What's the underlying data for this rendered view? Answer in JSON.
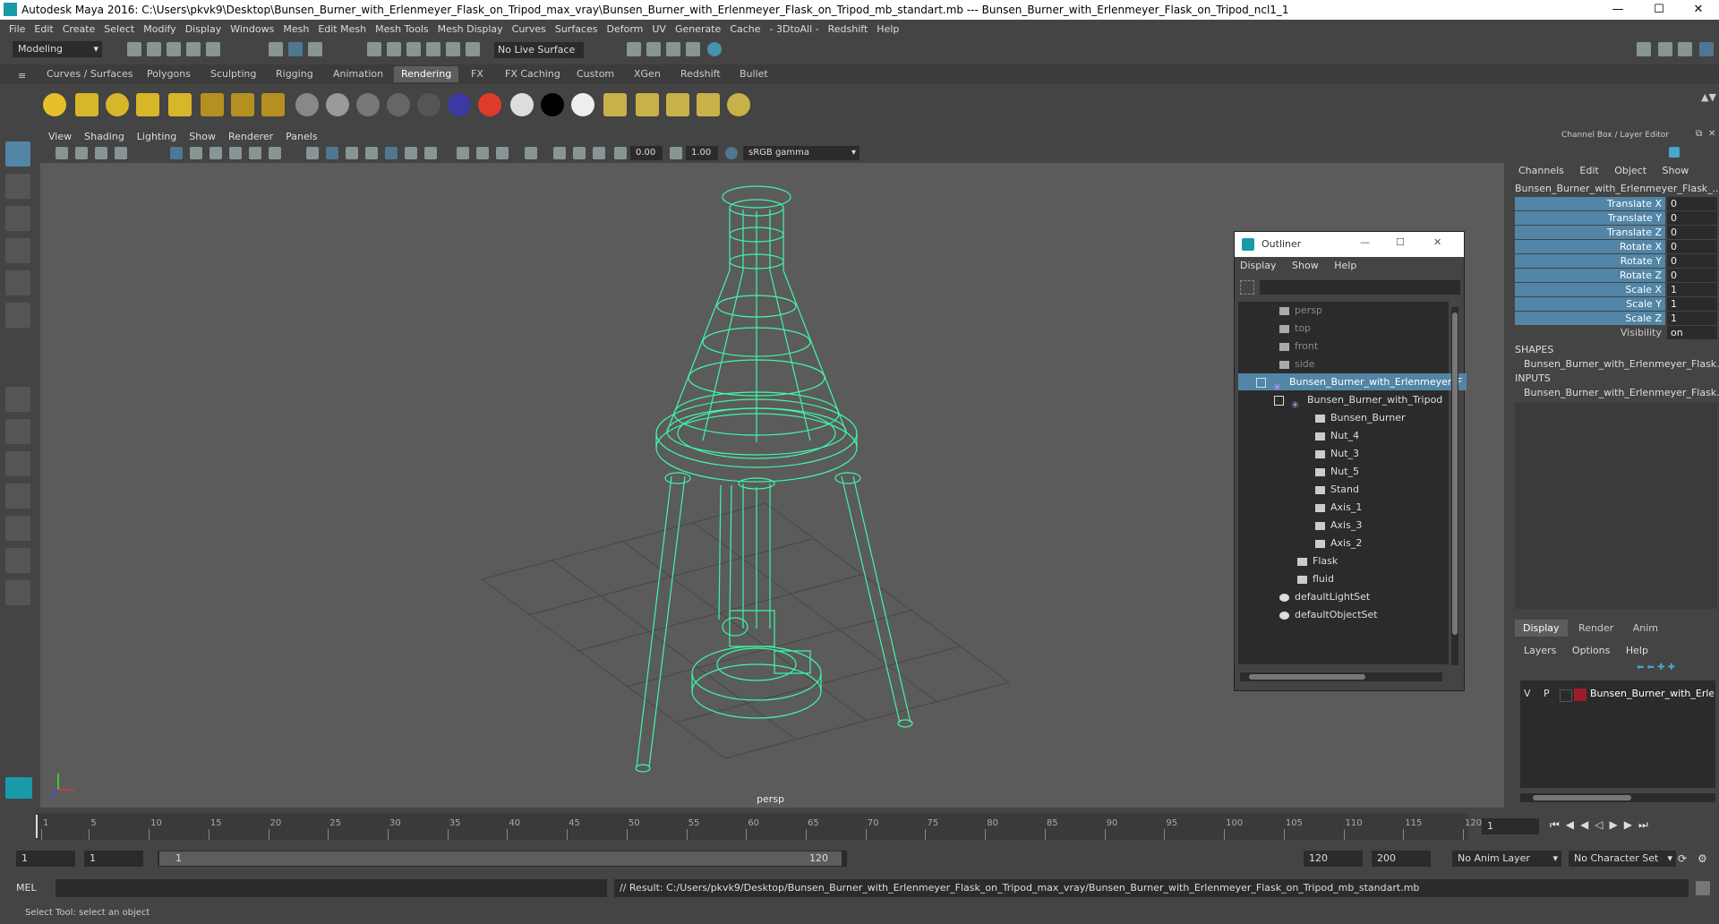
{
  "title": "Autodesk Maya 2016: C:\\Users\\pkvk9\\Desktop\\Bunsen_Burner_with_Erlenmeyer_Flask_on_Tripod_max_vray\\Bunsen_Burner_with_Erlenmeyer_Flask_on_Tripod_mb_standart.mb  ---  Bunsen_Burner_with_Erlenmeyer_Flask_on_Tripod_ncl1_1",
  "window_controls": {
    "minimize": "—",
    "maximize": "☐",
    "close": "✕"
  },
  "menu": [
    "File",
    "Edit",
    "Create",
    "Select",
    "Modify",
    "Display",
    "Windows",
    "Mesh",
    "Edit Mesh",
    "Mesh Tools",
    "Mesh Display",
    "Curves",
    "Surfaces",
    "Deform",
    "UV",
    "Generate",
    "Cache",
    "- 3DtoAll -",
    "Redshift",
    "Help"
  ],
  "status": {
    "mode": "Modeling",
    "live_surface": "No Live Surface"
  },
  "shelf_tabs": [
    "Curves / Surfaces",
    "Polygons",
    "Sculpting",
    "Rigging",
    "Animation",
    "Rendering",
    "FX",
    "FX Caching",
    "Custom",
    "XGen",
    "Redshift",
    "Bullet"
  ],
  "shelf_active": "Rendering",
  "viewport": {
    "menu": [
      "View",
      "Shading",
      "Lighting",
      "Show",
      "Renderer",
      "Panels"
    ],
    "exposure": "0.00",
    "gamma": "1.00",
    "color_space": "sRGB gamma",
    "camera": "persp"
  },
  "outliner": {
    "title": "Outliner",
    "menu": [
      "Display",
      "Show",
      "Help"
    ],
    "items": [
      {
        "label": "persp",
        "indent": 2,
        "dim": true
      },
      {
        "label": "top",
        "indent": 2,
        "dim": true
      },
      {
        "label": "front",
        "indent": 2,
        "dim": true
      },
      {
        "label": "side",
        "indent": 2,
        "dim": true
      },
      {
        "label": "Bunsen_Burner_with_Erlenmeyer_F",
        "indent": 1,
        "selected": true
      },
      {
        "label": "Bunsen_Burner_with_Tripod",
        "indent": 2
      },
      {
        "label": "Bunsen_Burner",
        "indent": 3
      },
      {
        "label": "Nut_4",
        "indent": 3
      },
      {
        "label": "Nut_3",
        "indent": 3
      },
      {
        "label": "Nut_5",
        "indent": 3
      },
      {
        "label": "Stand",
        "indent": 3
      },
      {
        "label": "Axis_1",
        "indent": 3
      },
      {
        "label": "Axis_3",
        "indent": 3
      },
      {
        "label": "Axis_2",
        "indent": 3
      },
      {
        "label": "Flask",
        "indent": 2
      },
      {
        "label": "fluid",
        "indent": 2
      },
      {
        "label": "defaultLightSet",
        "indent": 1
      },
      {
        "label": "defaultObjectSet",
        "indent": 1
      }
    ]
  },
  "channel_box": {
    "header": "Channel Box / Layer Editor",
    "menu": [
      "Channels",
      "Edit",
      "Object",
      "Show"
    ],
    "object": "Bunsen_Burner_with_Erlenmeyer_Flask_...",
    "attributes": [
      {
        "name": "Translate X",
        "value": "0"
      },
      {
        "name": "Translate Y",
        "value": "0"
      },
      {
        "name": "Translate Z",
        "value": "0"
      },
      {
        "name": "Rotate X",
        "value": "0"
      },
      {
        "name": "Rotate Y",
        "value": "0"
      },
      {
        "name": "Rotate Z",
        "value": "0"
      },
      {
        "name": "Scale X",
        "value": "1"
      },
      {
        "name": "Scale Y",
        "value": "1"
      },
      {
        "name": "Scale Z",
        "value": "1"
      },
      {
        "name": "Visibility",
        "value": "on"
      }
    ],
    "shapes_label": "SHAPES",
    "shapes_item": "Bunsen_Burner_with_Erlenmeyer_Flask...",
    "inputs_label": "INPUTS",
    "inputs_item": "Bunsen_Burner_with_Erlenmeyer_Flask...",
    "layer_tabs": [
      "Display",
      "Render",
      "Anim"
    ],
    "layer_menu": [
      "Layers",
      "Options",
      "Help"
    ],
    "layer": {
      "v": "V",
      "p": "P",
      "name": "Bunsen_Burner_with_Erle"
    }
  },
  "timeline": {
    "ticks": [
      "1",
      "5",
      "10",
      "15",
      "20",
      "25",
      "30",
      "35",
      "40",
      "45",
      "50",
      "55",
      "60",
      "65",
      "70",
      "75",
      "80",
      "85",
      "90",
      "95",
      "100",
      "105",
      "110",
      "115",
      "120"
    ],
    "current_frame": "1"
  },
  "range": {
    "start": "1",
    "start2": "1",
    "slider_start": "1",
    "slider_end": "120",
    "end": "120",
    "end2": "200",
    "anim_layer": "No Anim Layer",
    "char_set": "No Character Set"
  },
  "command": {
    "lang": "MEL",
    "result": "// Result: C:/Users/pkvk9/Desktop/Bunsen_Burner_with_Erlenmeyer_Flask_on_Tripod_max_vray/Bunsen_Burner_with_Erlenmeyer_Flask_on_Tripod_mb_standart.mb"
  },
  "help_line": "Select Tool: select an object",
  "colors": {
    "accent": "#5285a6",
    "wire": "#3ff7a8",
    "viewport_bg": "#5b5b5b",
    "layer_color": "#9b1c2e"
  }
}
